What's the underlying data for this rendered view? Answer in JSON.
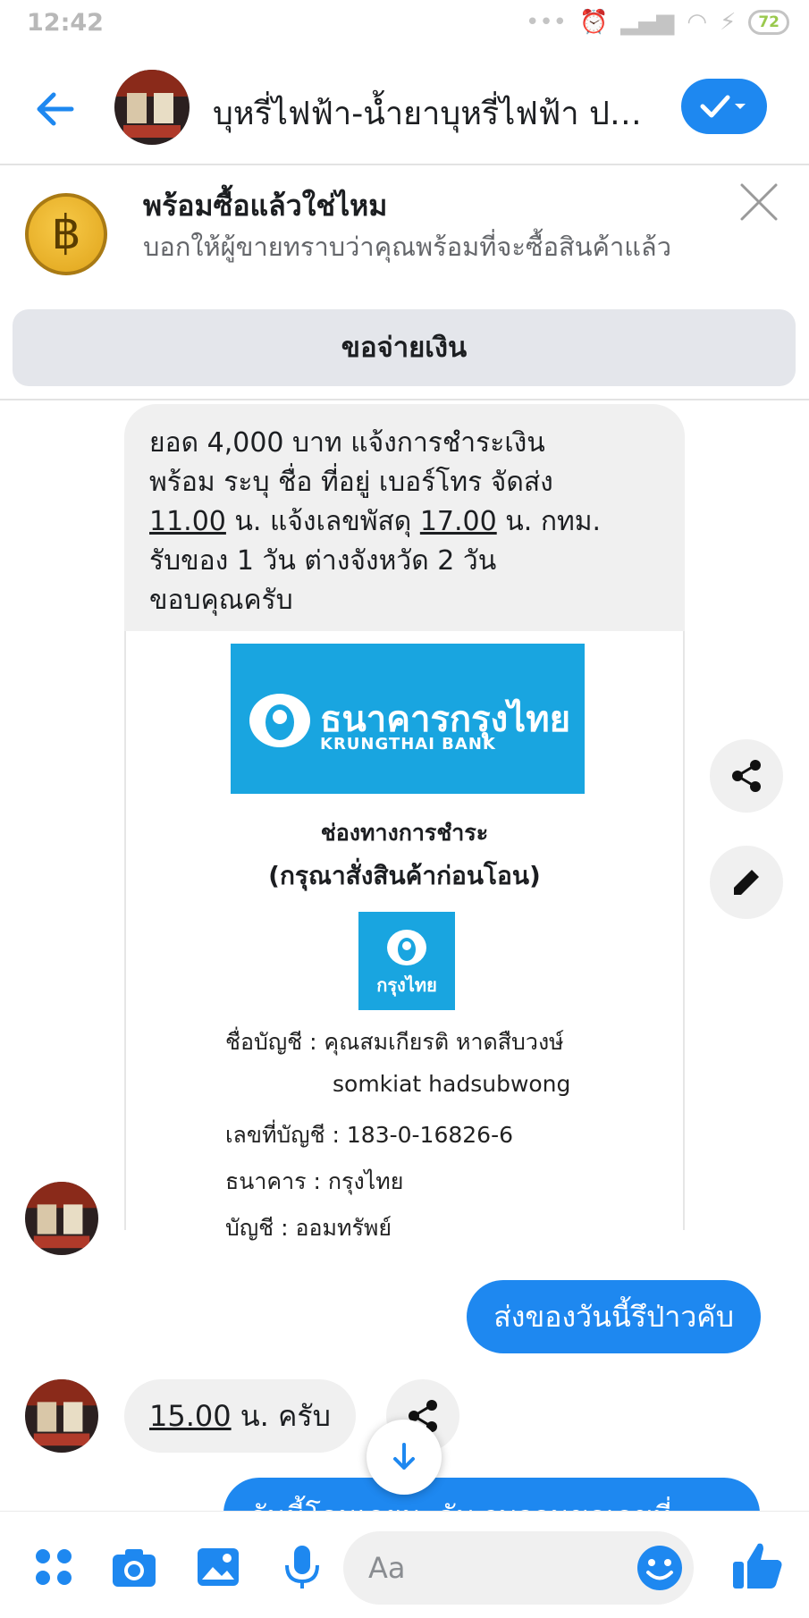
{
  "status_bar": {
    "time": "12:42",
    "battery": "72"
  },
  "header": {
    "title": "บุหรี่ไฟฟ้า-น้ำยาบุหรี่ไฟฟ้า ปรึ..."
  },
  "banner": {
    "title": "พร้อมซื้อแล้วใช่ไหม",
    "subtitle": "บอกให้ผู้ขายทราบว่าคุณพร้อมที่จะซื้อสินค้าแล้ว",
    "action_label": "ขอจ่ายเงิน",
    "coin_symbol": "฿"
  },
  "messages": {
    "incoming_1": {
      "line1": "ยอด 4,000 บาท แจ้งการชำระเงิน",
      "line2": "พร้อม ระบุ ชื่อ ที่อยู่ เบอร์โทร จัดส่ง",
      "line3_time1": "11.00",
      "line3_mid": " น. แจ้งเลขพัสดุ ",
      "line3_time2": "17.00",
      "line3_end": " น. กทม.",
      "line4": "รับของ 1 วัน ต่างจังหวัด 2 วัน",
      "line5": "ขอบคุณครับ"
    },
    "payment_image": {
      "bank_name_th": "ธนาคารกรุงไทย",
      "bank_name_en": "KRUNGTHAI BANK",
      "channel_title": "ช่องทางการชำระ",
      "channel_note": "(กรุณาสั่งสินค้าก่อนโอน)",
      "small_logo_text": "กรุงไทย",
      "account_name_line": "ชื่อบัญชี : คุณสมเกียรติ หาดสืบวงษ์",
      "account_name_en": "somkiat hadsubwong",
      "account_number_line": "เลขที่บัญชี : 183-0-16826-6",
      "bank_line": "ธนาคาร : กรุงไทย",
      "account_type_line": "บัญชี : ออมทรัพย์"
    },
    "outgoing_1": "ส่งของวันนี้รึป่าวคับ",
    "incoming_2_time": "15.00",
    "incoming_2_rest": " น. ครับ",
    "outgoing_2_partial": "วันนี้โอนเลยนะคับ รบกวนขอเลขที่"
  },
  "composer": {
    "placeholder": "Aa"
  },
  "colors": {
    "accent": "#1e88f0",
    "bubble_gray": "#f0f0f0",
    "bank_blue": "#19a5e0"
  }
}
